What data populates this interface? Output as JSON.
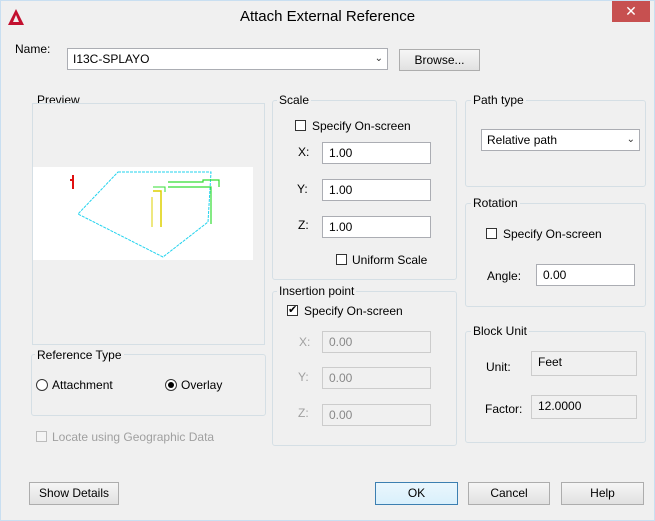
{
  "window": {
    "title": "Attach External Reference",
    "close_glyph": "✕"
  },
  "name_row": {
    "label": "Name:",
    "value": "I13C-SPLAYO",
    "browse_label": "Browse..."
  },
  "preview": {
    "label": "Preview"
  },
  "scale": {
    "label": "Scale",
    "specify_on_screen": {
      "label": "Specify On-screen",
      "checked": false
    },
    "x": {
      "label": "X:",
      "value": "1.00"
    },
    "y": {
      "label": "Y:",
      "value": "1.00"
    },
    "z": {
      "label": "Z:",
      "value": "1.00"
    },
    "uniform_scale": {
      "label": "Uniform Scale",
      "checked": false
    }
  },
  "insertion_point": {
    "label": "Insertion point",
    "specify_on_screen": {
      "label": "Specify On-screen",
      "checked": true
    },
    "x": {
      "label": "X:",
      "value": "0.00"
    },
    "y": {
      "label": "Y:",
      "value": "0.00"
    },
    "z": {
      "label": "Z:",
      "value": "0.00"
    }
  },
  "path_type": {
    "label": "Path type",
    "value": "Relative path"
  },
  "rotation": {
    "label": "Rotation",
    "specify_on_screen": {
      "label": "Specify On-screen",
      "checked": false
    },
    "angle": {
      "label": "Angle:",
      "value": "0.00"
    }
  },
  "block_unit": {
    "label": "Block Unit",
    "unit": {
      "label": "Unit:",
      "value": "Feet"
    },
    "factor": {
      "label": "Factor:",
      "value": "12.0000"
    }
  },
  "reference_type": {
    "label": "Reference Type",
    "attachment": {
      "label": "Attachment",
      "selected": false
    },
    "overlay": {
      "label": "Overlay",
      "selected": true
    }
  },
  "geographic": {
    "label": "Locate using Geographic Data",
    "checked": false,
    "enabled": false
  },
  "buttons": {
    "show_details": "Show Details",
    "ok": "OK",
    "cancel": "Cancel",
    "help": "Help"
  },
  "icons": {
    "app": "autocad-logo-icon",
    "close": "close-icon",
    "dropdown": "chevron-down-icon"
  },
  "colors": {
    "accent_red": "#c3102f",
    "close_bg": "#c75050",
    "preview_cyan": "#22d3ee",
    "preview_green": "#33dd33",
    "preview_yellow": "#ddd000"
  }
}
